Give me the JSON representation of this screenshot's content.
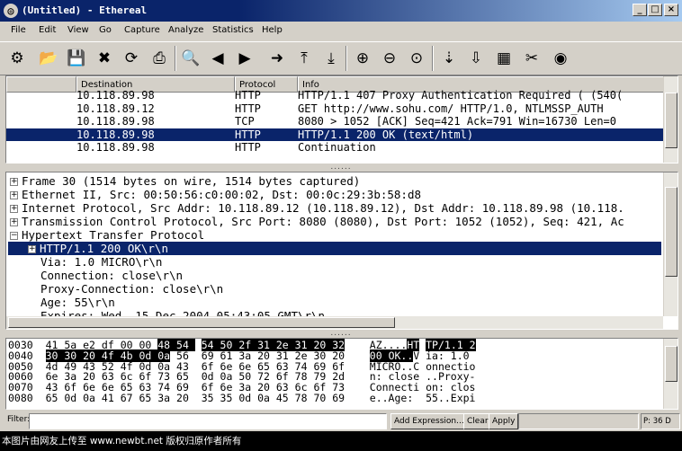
{
  "window": {
    "title": "(Untitled) - Ethereal",
    "minimize": "_",
    "maximize": "□",
    "close": "×"
  },
  "menu": [
    "File",
    "Edit",
    "View",
    "Go",
    "Capture",
    "Analyze",
    "Statistics",
    "Help"
  ],
  "toolbar": [
    "gear-icon",
    "folder-open-icon",
    "save-icon",
    "close-icon",
    "reload-icon",
    "print-icon",
    "find-icon",
    "back-icon",
    "forward-icon",
    "goto-icon",
    "first-packet-icon",
    "last-packet-icon",
    "zoom-in-icon",
    "zoom-out-icon",
    "zoom-normal-icon",
    "capture-filters-icon",
    "display-filters-icon",
    "coloring-rules-icon",
    "preferences-icon",
    "help-icon"
  ],
  "packet_list": {
    "columns": [
      "Destination",
      "Protocol",
      "Info"
    ],
    "rows": [
      {
        "destination": "10.118.89.98",
        "protocol": "HTTP",
        "info": "HTTP/1.1 407 Proxy Authentication Required ( (540(",
        "selected": false
      },
      {
        "destination": "10.118.89.12",
        "protocol": "HTTP",
        "info": "GET http://www.sohu.com/ HTTP/1.0, NTLMSSP_AUTH",
        "selected": false
      },
      {
        "destination": "10.118.89.98",
        "protocol": "TCP",
        "info": "8080 > 1052 [ACK] Seq=421 Ack=791 Win=16730 Len=0",
        "selected": false
      },
      {
        "destination": "10.118.89.98",
        "protocol": "HTTP",
        "info": "HTTP/1.1 200 OK (text/html)",
        "selected": true
      },
      {
        "destination": "10.118.89.98",
        "protocol": "HTTP",
        "info": "Continuation",
        "selected": false
      }
    ]
  },
  "grip": "......",
  "details": [
    {
      "text": "Frame 30 (1514 bytes on wire, 1514 bytes captured)",
      "expander": "+",
      "indent": 0,
      "selected": false
    },
    {
      "text": "Ethernet II, Src: 00:50:56:c0:00:02, Dst: 00:0c:29:3b:58:d8",
      "expander": "+",
      "indent": 0,
      "selected": false
    },
    {
      "text": "Internet Protocol, Src Addr: 10.118.89.12 (10.118.89.12), Dst Addr: 10.118.89.98 (10.118.",
      "expander": "+",
      "indent": 0,
      "selected": false
    },
    {
      "text": "Transmission Control Protocol, Src Port: 8080 (8080), Dst Port: 1052 (1052), Seq: 421, Ac",
      "expander": "+",
      "indent": 0,
      "selected": false
    },
    {
      "text": "Hypertext Transfer Protocol",
      "expander": "−",
      "indent": 0,
      "selected": false
    },
    {
      "text": "HTTP/1.1 200 OK\\r\\n",
      "expander": "+",
      "indent": 1,
      "selected": true
    },
    {
      "text": "Via: 1.0 MICRO\\r\\n",
      "expander": "",
      "indent": 2,
      "selected": false
    },
    {
      "text": "Connection: close\\r\\n",
      "expander": "",
      "indent": 2,
      "selected": false
    },
    {
      "text": "Proxy-Connection: close\\r\\n",
      "expander": "",
      "indent": 2,
      "selected": false
    },
    {
      "text": "Age: 55\\r\\n",
      "expander": "",
      "indent": 2,
      "selected": false
    },
    {
      "text": "Expires: Wed, 15 Dec 2004 05:43:05 GMT\\r\\n",
      "expander": "",
      "indent": 2,
      "selected": false
    }
  ],
  "hex": [
    {
      "offset": "0030",
      "bytes": [
        "41",
        "5a",
        "e2",
        "df",
        "00",
        "00",
        "48",
        "54",
        " ",
        "54",
        "50",
        "2f",
        "31",
        "2e",
        "31",
        "20",
        "32"
      ],
      "ascii": "AZ....HT TP/1.1 2",
      "hl_bytes": [
        6,
        7,
        9,
        10,
        11,
        12,
        13,
        14,
        15,
        16
      ],
      "hl_ascii": [
        6,
        7,
        9,
        10,
        11,
        12,
        13,
        14,
        15,
        16
      ]
    },
    {
      "offset": "0040",
      "bytes": [
        "30",
        "30",
        "20",
        "4f",
        "4b",
        "0d",
        "0a",
        "56",
        " ",
        "69",
        "61",
        "3a",
        "20",
        "31",
        "2e",
        "30",
        "20"
      ],
      "ascii": "00 OK..V ia: 1.0 ",
      "hl_bytes": [
        0,
        1,
        2,
        3,
        4,
        5,
        6
      ],
      "hl_ascii": [
        0,
        1,
        2,
        3,
        4,
        5,
        6
      ]
    },
    {
      "offset": "0050",
      "bytes": [
        "4d",
        "49",
        "43",
        "52",
        "4f",
        "0d",
        "0a",
        "43",
        " ",
        "6f",
        "6e",
        "6e",
        "65",
        "63",
        "74",
        "69",
        "6f"
      ],
      "ascii": "MICRO..C onnectio",
      "hl_bytes": [],
      "hl_ascii": []
    },
    {
      "offset": "0060",
      "bytes": [
        "6e",
        "3a",
        "20",
        "63",
        "6c",
        "6f",
        "73",
        "65",
        " ",
        "0d",
        "0a",
        "50",
        "72",
        "6f",
        "78",
        "79",
        "2d"
      ],
      "ascii": "n: close ..Proxy-",
      "hl_bytes": [],
      "hl_ascii": []
    },
    {
      "offset": "0070",
      "bytes": [
        "43",
        "6f",
        "6e",
        "6e",
        "65",
        "63",
        "74",
        "69",
        " ",
        "6f",
        "6e",
        "3a",
        "20",
        "63",
        "6c",
        "6f",
        "73"
      ],
      "ascii": "Connecti on: clos",
      "hl_bytes": [],
      "hl_ascii": []
    },
    {
      "offset": "0080",
      "bytes": [
        "65",
        "0d",
        "0a",
        "41",
        "67",
        "65",
        "3a",
        "20",
        " ",
        "35",
        "35",
        "0d",
        "0a",
        "45",
        "78",
        "70",
        "69"
      ],
      "ascii": "e..Age:  55..Expi",
      "hl_bytes": [],
      "hl_ascii": []
    }
  ],
  "statusbar": {
    "filter_label": "Filter:",
    "filter_value": "",
    "add_expression": "Add Expression...",
    "clear": "Clear",
    "apply": "Apply",
    "packet_info": "P: 36 D"
  },
  "footer": "本图片由网友上传至 www.newbt.net 版权归原作者所有"
}
